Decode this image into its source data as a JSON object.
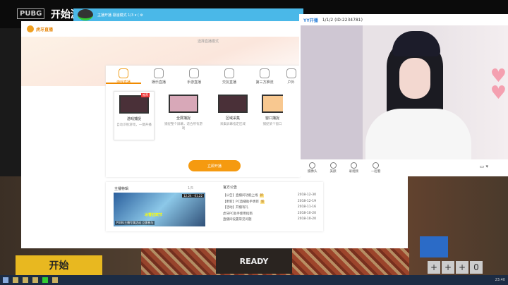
{
  "game": {
    "logo": "PUBG",
    "title": "开始游戏",
    "start_button": "开始",
    "ready_button": "READY",
    "plus_buttons": [
      "+",
      "+",
      "+"
    ],
    "party_count": "0"
  },
  "yy_bar": {
    "text": "主播开播 极速模式 1/3 ▾ ⟨ ⚙"
  },
  "huya": {
    "logo": "虎牙直播",
    "mode_title": "选择直播模式",
    "tabs": [
      {
        "label": "游戏直播",
        "icon": "gamepad-icon"
      },
      {
        "label": "娱乐直播",
        "icon": "microphone-icon"
      },
      {
        "label": "手游直播",
        "icon": "phone-icon"
      },
      {
        "label": "交友直播",
        "icon": "heart-icon"
      },
      {
        "label": "第三方推流",
        "icon": "share-icon"
      },
      {
        "label": "户外",
        "icon": "outdoor-icon"
      }
    ],
    "cards": [
      {
        "name": "游戏捕捉",
        "desc": "自动识别游戏，一键开播",
        "badge": "推荐"
      },
      {
        "name": "全屏捕捉",
        "desc": "捕捉整个屏幕，适合所有游戏"
      },
      {
        "name": "区域采集",
        "desc": "采集屏幕指定区域"
      },
      {
        "name": "窗口捕捉",
        "desc": "捕捉某个窗口"
      }
    ],
    "go_button": "立即开播",
    "featured": {
      "title": "主播特辑",
      "pager": "1/5",
      "banner_date": "12.24 - 01.22",
      "banner_event": "冰雪狂欢节",
      "banner_caption": "PUBG主播专属活动 立即参与"
    },
    "announcements": {
      "title": "官方公告",
      "items": [
        {
          "text": "【公告】直播间功能上线",
          "tag": "新",
          "date": "2018-12-30"
        },
        {
          "text": "【更新】PC直播助手更新",
          "tag": "新",
          "date": "2018-12-19"
        },
        {
          "text": "【活动】开播有礼",
          "date": "2018-11-16"
        },
        {
          "text": "虎牙PC助手使用指南",
          "date": "2018-10-20"
        },
        {
          "text": "直播间设置常见问题",
          "date": "2018-10-20"
        }
      ]
    }
  },
  "yy": {
    "brand": "YY开播",
    "room": "1/1/2 (ID:2234781)",
    "tools": [
      "摄像头",
      "美颜",
      "录视频",
      "一起看"
    ]
  },
  "taskbar": {
    "clock": "23:40"
  }
}
